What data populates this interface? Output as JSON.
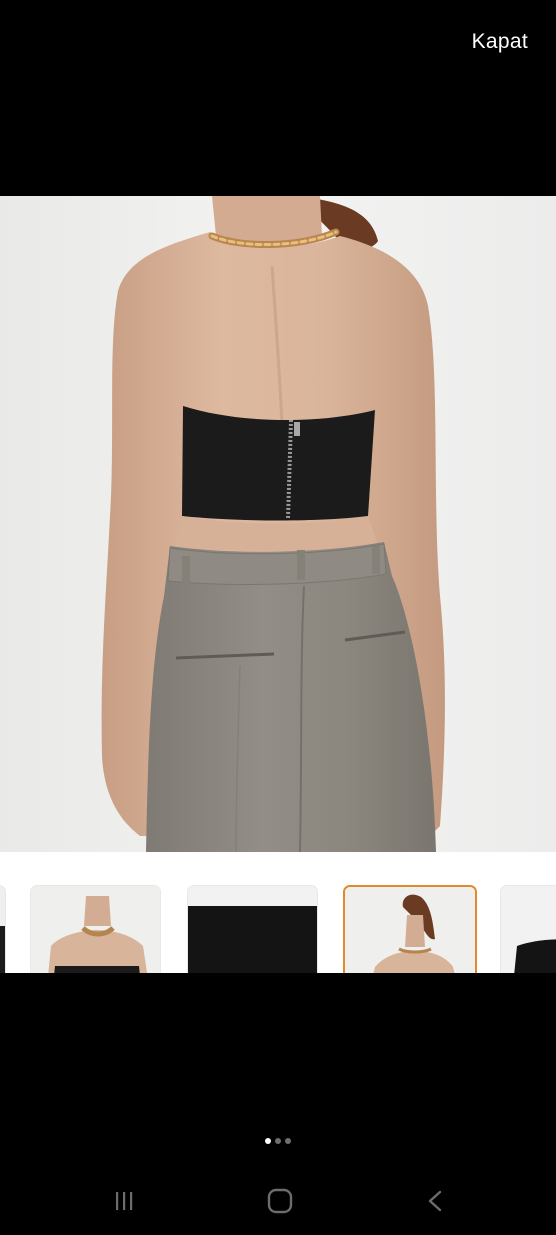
{
  "header": {
    "close_label": "Kapat"
  },
  "gallery": {
    "thumbnails": [
      {
        "icon": "product-thumbnail-partial-left",
        "selected": false
      },
      {
        "icon": "product-thumbnail-front-necklace",
        "selected": false
      },
      {
        "icon": "product-thumbnail-black-fabric",
        "selected": false
      },
      {
        "icon": "product-thumbnail-back-view",
        "selected": true
      },
      {
        "icon": "product-thumbnail-partial-right",
        "selected": false
      }
    ],
    "page_count": 3,
    "active_page": 1
  },
  "colors": {
    "background": "#000000",
    "selected_border": "#e2892b",
    "top_black": "#1a1a1a",
    "trousers_grey": "#8b877f",
    "skin": "#d8b59c"
  },
  "navigation": {
    "buttons": [
      "recent-apps-icon",
      "home-icon",
      "back-icon"
    ]
  }
}
